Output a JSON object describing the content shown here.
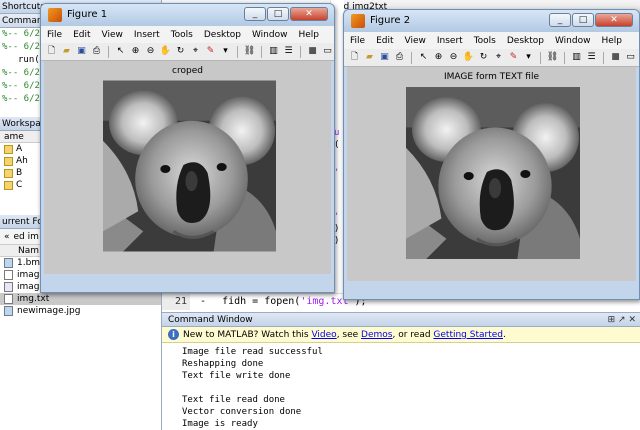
{
  "desktop": {
    "editor_title": "ed img2txt",
    "left_panel": {
      "shortcuts_label": "Shortcuts",
      "command_history_label": "Command H",
      "history_lines": [
        "%-- 6/2",
        "%-- 6/2",
        "run(",
        "%-- 6/2",
        "%-- 6/2",
        "%-- 6/2"
      ],
      "workspace_label": "Workspace",
      "workspace_column": "ame",
      "workspace_vars": [
        "A",
        "Ah",
        "B",
        "C"
      ],
      "current_folder_label": "urrent Folde",
      "folder_path": "ed im",
      "folder_column": "Nam",
      "files": [
        {
          "name": "1.bmp",
          "selected": false
        },
        {
          "name": "image_file_io.asv",
          "selected": false
        },
        {
          "name": "image_file_io.m",
          "selected": false
        },
        {
          "name": "img.txt",
          "selected": true
        },
        {
          "name": "newimage.jpg",
          "selected": false
        }
      ]
    },
    "code_line": {
      "number": "21",
      "dash": "-",
      "code": "fidh = fopen(",
      "string": "'img.txt'",
      "tail": ");"
    },
    "command_window": {
      "title": "Command Window",
      "news": {
        "prefix": "New to MATLAB? Watch this ",
        "video": "Video",
        "mid1": ", see ",
        "demos": "Demos",
        "mid2": ", or read ",
        "getting_started": "Getting Started",
        "suffix": "."
      },
      "output": [
        "Image file read successful",
        "Reshapping done",
        "Text file write done",
        "",
        "Text file read done",
        "Vector conversion done",
        "Image is ready"
      ]
    }
  },
  "figure1": {
    "title": "Figure 1",
    "menu": [
      "File",
      "Edit",
      "View",
      "Insert",
      "Tools",
      "Desktop",
      "Window",
      "Help"
    ],
    "axes_title": "croped"
  },
  "figure2": {
    "title": "Figure 2",
    "menu": [
      "File",
      "Edit",
      "View",
      "Insert",
      "Tools",
      "Desktop",
      "Window",
      "Help"
    ],
    "axes_title": "IMAGE form TEXT file"
  },
  "icons": [
    "new-file-icon",
    "open-folder-icon",
    "save-icon",
    "print-icon",
    "pointer-icon",
    "zoom-in-icon",
    "zoom-out-icon",
    "pan-icon",
    "rotate-icon",
    "data-cursor-icon",
    "brush-icon",
    "link-icon",
    "colorbar-icon",
    "legend-icon",
    "hide-tools-icon",
    "show-tools-icon"
  ]
}
